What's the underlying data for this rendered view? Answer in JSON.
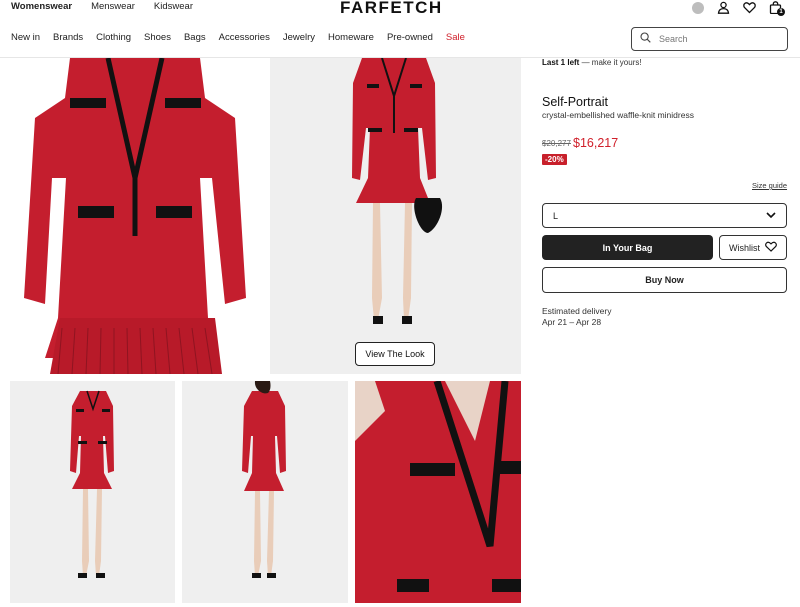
{
  "header": {
    "gender_tabs": [
      "Womenswear",
      "Menswear",
      "Kidswear"
    ],
    "logo": "FARFETCH",
    "bag_count": "1",
    "icons": [
      "account-circle-icon",
      "user-icon",
      "heart-icon",
      "bag-icon"
    ]
  },
  "nav": {
    "categories": [
      "New in",
      "Brands",
      "Clothing",
      "Shoes",
      "Bags",
      "Accessories",
      "Jewelry",
      "Homeware",
      "Pre-owned",
      "Sale"
    ],
    "search_placeholder": "Search"
  },
  "gallery": {
    "view_look_label": "View The Look"
  },
  "product": {
    "stock_bold": "Last 1 left",
    "stock_rest": " — make it yours!",
    "brand": "Self-Portrait",
    "name": "crystal-embellished waffle-knit minidress",
    "old_price": "$20,277",
    "new_price": "$16,217",
    "discount": "-20%",
    "size_guide": "Size guide",
    "selected_size": "L",
    "add_to_bag": "In Your Bag",
    "wishlist": "Wishlist",
    "buy_now": "Buy Now",
    "delivery_label": "Estimated delivery",
    "delivery_dates": "Apr 21 – Apr 28"
  },
  "colors": {
    "sale_red": "#d0202b",
    "dress_red": "#c41e2e",
    "button_dark": "#222222"
  }
}
